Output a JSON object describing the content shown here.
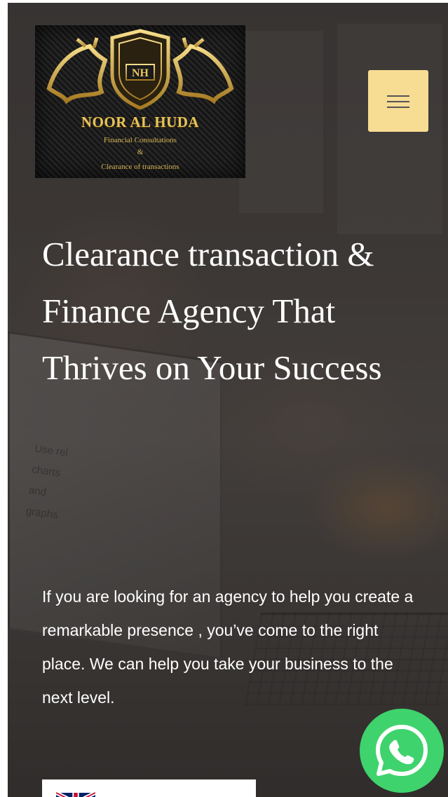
{
  "brand": {
    "name": "NOOR AL HUDA",
    "tagline_line1": "Financial Consultations",
    "tagline_amp": "&",
    "tagline_line2": "Clearance of transactions",
    "monogram": "NH"
  },
  "hero": {
    "headline": "Clearance transaction & Finance Agency That Thrives on Your Success",
    "intro": "If you are looking for an agency to help you create a remarkable presence , you’ve come to the right place. We can help you take your business to the next level.",
    "background_texture": "Use rel charts and graphs"
  },
  "colors": {
    "menu_button": "#f7dc94",
    "gold": "#e8c45a",
    "whatsapp_green": "#3fd36d"
  },
  "icons": {
    "menu": "hamburger-icon",
    "whatsapp": "whatsapp-icon",
    "flag": "uk-flag-icon"
  }
}
